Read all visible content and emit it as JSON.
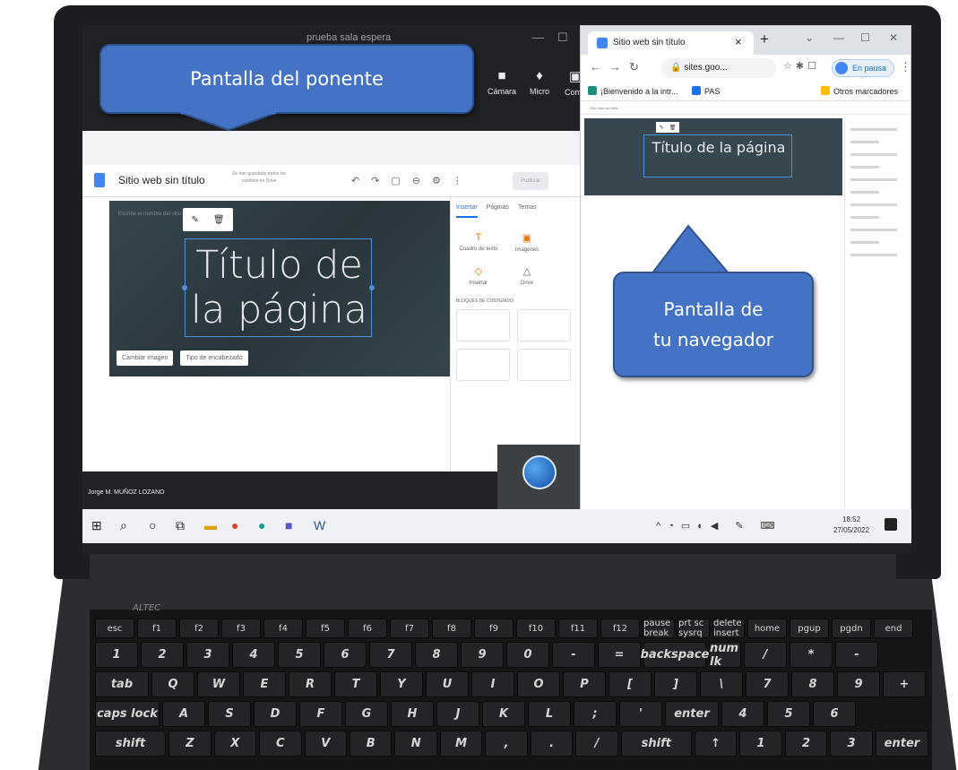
{
  "meeting": {
    "window_title": "prueba sala espera",
    "controls": [
      "Cámara",
      "Micro",
      "Comp"
    ],
    "speaker_name": "Jorge M. MUÑOZ LOZANO"
  },
  "shared_screen": {
    "site_title": "Sitio web sin título",
    "save_status": "Se han guardado todos los cambios en Drive",
    "publish_label": "Publicar",
    "hero_hint": "Escribe el nombre del sitio",
    "hero_title": "Título de la página",
    "change_image_label": "Cambiar imagen",
    "header_type_label": "Tipo de encabezado",
    "panel_tabs": [
      "Insertar",
      "Páginas",
      "Temas"
    ],
    "panel_items": [
      "Cuadro de texto",
      "Imágenes",
      "Insertar",
      "Drive"
    ],
    "content_blocks_label": "BLOQUES DE CONTENIDO"
  },
  "browser": {
    "tab_title": "Sitio web sin título",
    "url": "sites.goo...",
    "pause_label": "En pausa",
    "bookmarks": [
      "¡Bienvenido a la intr...",
      "PAS"
    ],
    "other_bookmarks": "Otros marcadores",
    "page_header_text": "Sitio web sin título",
    "hero_title": "Título de la página"
  },
  "taskbar": {
    "time": "18:52",
    "date": "27/05/2022"
  },
  "keyboard": {
    "brand": "ALTEC",
    "rows": [
      [
        "esc",
        "f1",
        "f2",
        "f3",
        "f4",
        "f5",
        "f6",
        "f7",
        "f8",
        "f9",
        "f10",
        "f11",
        "f12",
        "pause break",
        "prt sc sysrq",
        "delete insert",
        "home",
        "pgup",
        "pgdn",
        "end"
      ],
      [
        "1",
        "2",
        "3",
        "4",
        "5",
        "6",
        "7",
        "8",
        "9",
        "0",
        "-",
        "=",
        "backspace",
        "num lk",
        "/",
        "*",
        "-"
      ],
      [
        "tab",
        "Q",
        "W",
        "E",
        "R",
        "T",
        "Y",
        "U",
        "I",
        "O",
        "P",
        "[",
        "]",
        "\\",
        "7",
        "8",
        "9",
        "+"
      ],
      [
        "caps lock",
        "A",
        "S",
        "D",
        "F",
        "G",
        "H",
        "J",
        "K",
        "L",
        ";",
        "'",
        "enter",
        "4",
        "5",
        "6"
      ],
      [
        "shift",
        "Z",
        "X",
        "C",
        "V",
        "B",
        "N",
        "M",
        ",",
        ".",
        "/",
        "shift",
        "↑",
        "1",
        "2",
        "3",
        "enter"
      ]
    ]
  },
  "callouts": {
    "speaker_screen": "Pantalla del ponente",
    "browser_screen_line1": "Pantalla de",
    "browser_screen_line2": "tu navegador"
  },
  "colors": {
    "callout_fill": "#4472c4",
    "callout_border": "#2f528f",
    "hero_bg": "#37474f",
    "accent_blue": "#1a73e8"
  }
}
